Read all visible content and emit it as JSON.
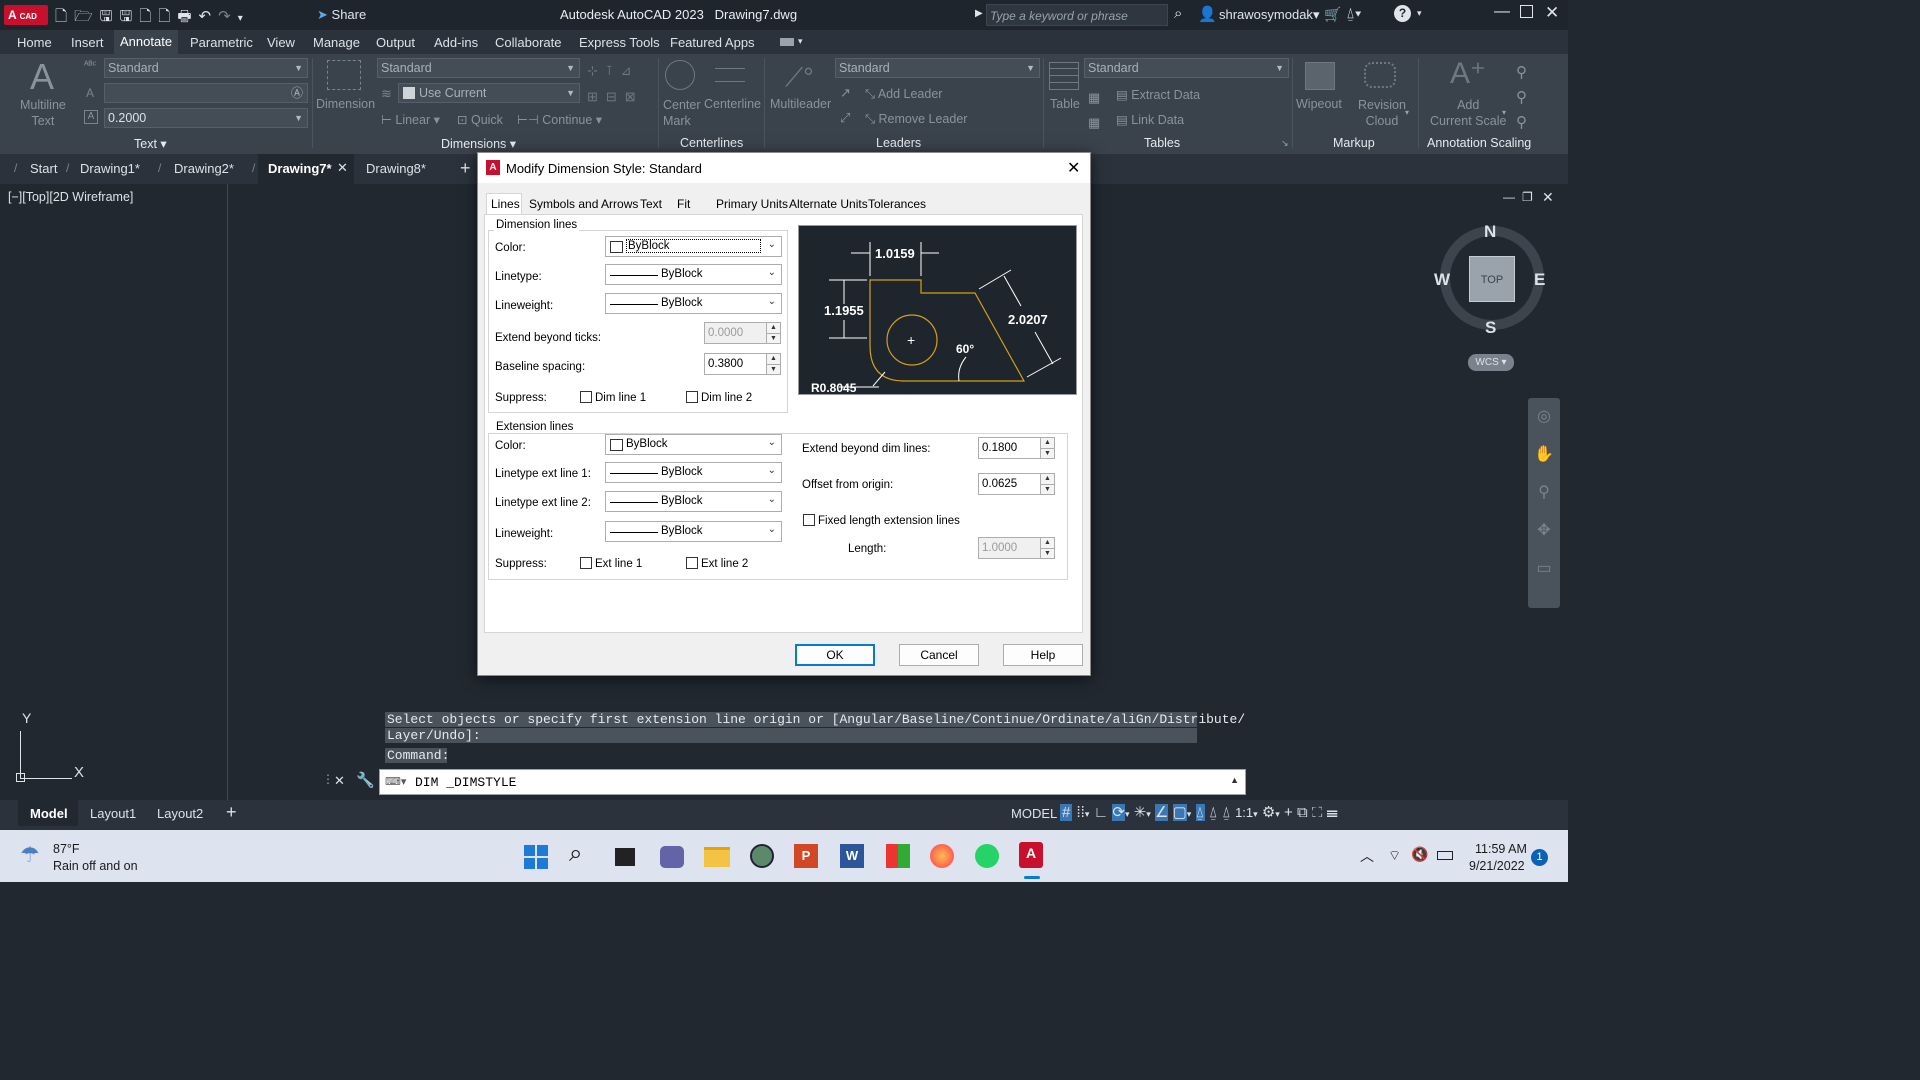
{
  "app": {
    "title": "Autodesk AutoCAD 2023",
    "filename": "Drawing7.dwg",
    "search_placeholder": "Type a keyword or phrase",
    "user": "shrawosymodak",
    "share_label": "Share",
    "logo_text": "CAD"
  },
  "ribbon_tabs": [
    "Home",
    "Insert",
    "Annotate",
    "Parametric",
    "View",
    "Manage",
    "Output",
    "Add-ins",
    "Collaborate",
    "Express Tools",
    "Featured Apps"
  ],
  "ribbon": {
    "text_panel": {
      "label": "Text",
      "multiline": "Multiline",
      "multiline2": "Text",
      "style": "Standard",
      "height": "0.2000"
    },
    "dimensions_panel": {
      "label": "Dimensions",
      "dimension": "Dimension",
      "style": "Standard",
      "layer": "Use Current",
      "linear": "Linear",
      "quick": "Quick",
      "continue": "Continue"
    },
    "centerlines_panel": {
      "label": "Centerlines",
      "center_mark": "Center",
      "center_mark2": "Mark",
      "centerline": "Centerline"
    },
    "leaders_panel": {
      "label": "Leaders",
      "multileader": "Multileader",
      "style": "Standard",
      "add": "Add Leader",
      "remove": "Remove Leader"
    },
    "tables_panel": {
      "label": "Tables",
      "table": "Table",
      "style": "Standard",
      "extract": "Extract Data",
      "link": "Link Data"
    },
    "markup_panel": {
      "label": "Markup",
      "wipeout": "Wipeout",
      "revision": "Revision",
      "revision2": "Cloud"
    },
    "scaling_panel": {
      "label": "Annotation Scaling",
      "add": "Add",
      "add2": "Current Scale"
    }
  },
  "doc_tabs": [
    "Start",
    "Drawing1*",
    "Drawing2*",
    "Drawing7*",
    "Drawing8*"
  ],
  "viewport_label": "[−][Top][2D Wireframe]",
  "viewcube": {
    "n": "N",
    "s": "S",
    "e": "E",
    "w": "W",
    "top": "TOP",
    "wcs": "WCS"
  },
  "ucs": {
    "y": "Y",
    "x": "X"
  },
  "dialog": {
    "title": "Modify Dimension Style: Standard",
    "tabs": [
      "Lines",
      "Symbols and Arrows",
      "Text",
      "Fit",
      "Primary Units",
      "Alternate Units",
      "Tolerances"
    ],
    "dim_lines": {
      "header": "Dimension lines",
      "color_label": "Color:",
      "color": "ByBlock",
      "linetype_label": "Linetype:",
      "linetype": "ByBlock",
      "lineweight_label": "Lineweight:",
      "lineweight": "ByBlock",
      "extend_label": "Extend beyond ticks:",
      "extend": "0.0000",
      "baseline_label": "Baseline spacing:",
      "baseline": "0.3800",
      "suppress_label": "Suppress:",
      "dim1": "Dim line 1",
      "dim2": "Dim line 2"
    },
    "ext_lines": {
      "header": "Extension lines",
      "color_label": "Color:",
      "color": "ByBlock",
      "lt1_label": "Linetype ext line 1:",
      "lt1": "ByBlock",
      "lt2_label": "Linetype ext line 2:",
      "lt2": "ByBlock",
      "lineweight_label": "Lineweight:",
      "lineweight": "ByBlock",
      "suppress_label": "Suppress:",
      "ext1": "Ext line 1",
      "ext2": "Ext line 2",
      "beyond_label": "Extend beyond dim lines:",
      "beyond": "0.1800",
      "offset_label": "Offset from origin:",
      "offset": "0.0625",
      "fixed_label": "Fixed length extension lines",
      "length_label": "Length:",
      "length": "1.0000"
    },
    "preview": {
      "d1": "1.0159",
      "d2": "1.1955",
      "d3": "2.0207",
      "angle": "60°",
      "radius": "R0.8045"
    },
    "buttons": {
      "ok": "OK",
      "cancel": "Cancel",
      "help": "Help"
    }
  },
  "command": {
    "history1": "Select objects or specify first extension line origin or [Angular/Baseline/Continue/Ordinate/aliGn/Distribute/",
    "history2": "Layer/Undo]:",
    "history3": "Command:",
    "input": "DIM _DIMSTYLE"
  },
  "layout_tabs": [
    "Model",
    "Layout1",
    "Layout2"
  ],
  "status": {
    "model": "MODEL",
    "scale": "1:1"
  },
  "taskbar": {
    "temp": "87°F",
    "weather": "Rain off and on",
    "time": "11:59 AM",
    "date": "9/21/2022",
    "badge": "1"
  },
  "colors": {
    "accent": "#0a7acf",
    "autocad_red": "#c8102e",
    "preview_bg": "#1f252d",
    "preview_line": "#d4a017"
  }
}
